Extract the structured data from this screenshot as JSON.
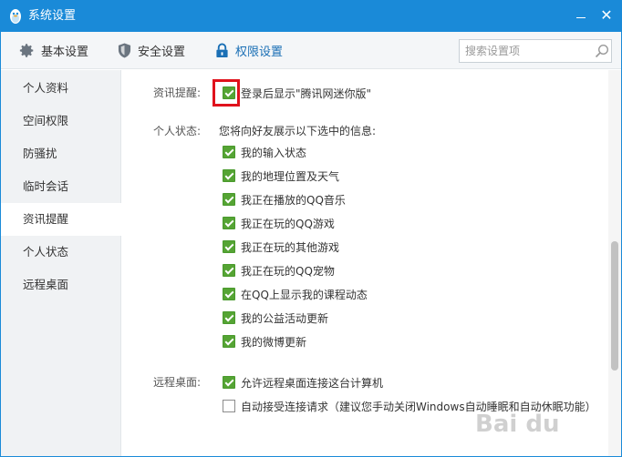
{
  "window": {
    "title": "系统设置"
  },
  "tabs": [
    {
      "label": "基本设置",
      "icon": "gear-icon"
    },
    {
      "label": "安全设置",
      "icon": "shield-icon"
    },
    {
      "label": "权限设置",
      "icon": "lock-icon",
      "active": true
    }
  ],
  "search": {
    "placeholder": "搜索设置项"
  },
  "sidebar": {
    "items": [
      {
        "label": "个人资料"
      },
      {
        "label": "空间权限"
      },
      {
        "label": "防骚扰"
      },
      {
        "label": "临时会话"
      },
      {
        "label": "资讯提醒",
        "active": true
      },
      {
        "label": "个人状态"
      },
      {
        "label": "远程桌面"
      }
    ]
  },
  "news": {
    "label": "资讯提醒:",
    "option": {
      "label": "登录后显示\"腾讯网迷你版\"",
      "checked": true
    }
  },
  "status": {
    "label": "个人状态:",
    "intro": "您将向好友展示以下选中的信息:",
    "options": [
      {
        "label": "我的输入状态",
        "checked": true
      },
      {
        "label": "我的地理位置及天气",
        "checked": true
      },
      {
        "label": "我正在播放的QQ音乐",
        "checked": true
      },
      {
        "label": "我正在玩的QQ游戏",
        "checked": true
      },
      {
        "label": "我正在玩的其他游戏",
        "checked": true
      },
      {
        "label": "我正在玩的QQ宠物",
        "checked": true
      },
      {
        "label": "在QQ上显示我的课程动态",
        "checked": true
      },
      {
        "label": "我的公益活动更新",
        "checked": true
      },
      {
        "label": "我的微博更新",
        "checked": true
      }
    ]
  },
  "remote": {
    "label": "远程桌面:",
    "options": [
      {
        "label": "允许远程桌面连接这台计算机",
        "checked": true
      },
      {
        "label": "自动接受连接请求（建议您手动关闭Windows自动睡眠和自动休眠功能）",
        "checked": false
      }
    ]
  },
  "watermark": "Bai du",
  "colors": {
    "titlebar": "#1a8ad8",
    "check": "#55a434",
    "highlight": "#e0121c"
  }
}
